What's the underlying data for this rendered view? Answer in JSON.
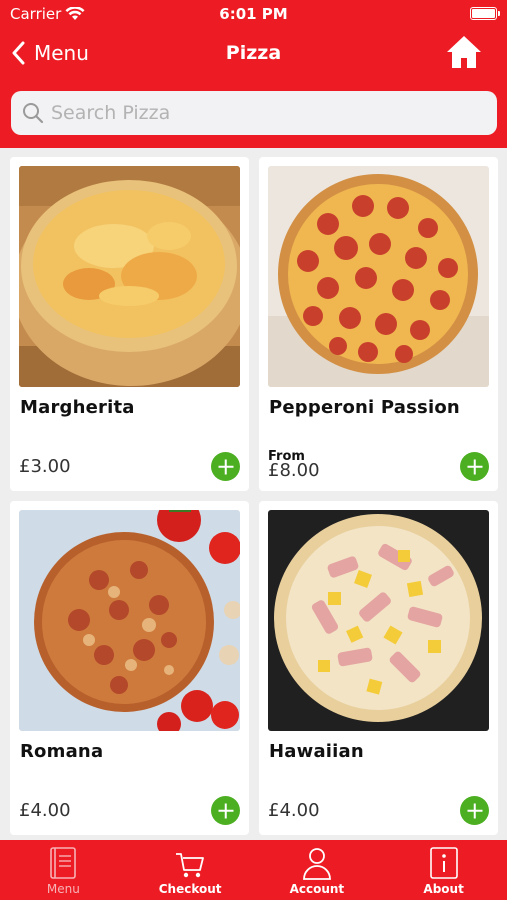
{
  "status_bar": {
    "carrier": "Carrier",
    "time": "6:01 PM",
    "battery_level": 1.0
  },
  "navbar": {
    "back_label": "Menu",
    "title": "Pizza"
  },
  "search": {
    "placeholder": "Search Pizza",
    "value": ""
  },
  "products": [
    {
      "name": "Margherita",
      "from_label": "",
      "price": "£3.00",
      "image": "margherita-pizza"
    },
    {
      "name": "Pepperoni Passion",
      "from_label": "From",
      "price": "£8.00",
      "image": "pepperoni-pizza"
    },
    {
      "name": "Romana",
      "from_label": "",
      "price": "£4.00",
      "image": "romana-pizza"
    },
    {
      "name": "Hawaiian",
      "from_label": "",
      "price": "£4.00",
      "image": "hawaiian-pizza"
    }
  ],
  "tabs": [
    {
      "label": "Menu",
      "icon": "menu-book-icon",
      "active": false
    },
    {
      "label": "Checkout",
      "icon": "cart-icon",
      "active": true
    },
    {
      "label": "Account",
      "icon": "person-icon",
      "active": true
    },
    {
      "label": "About",
      "icon": "info-icon",
      "active": true
    }
  ],
  "colors": {
    "brand": "#ed1c24",
    "add_button": "#4caf22",
    "background": "#eeeeee"
  }
}
